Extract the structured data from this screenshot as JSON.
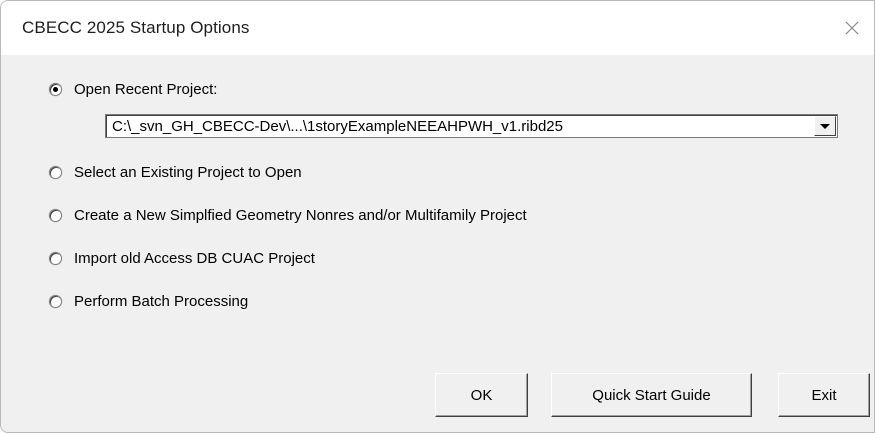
{
  "window": {
    "title": "CBECC 2025 Startup Options"
  },
  "options": {
    "open_recent": "Open Recent Project:",
    "select_existing": "Select an Existing Project to Open",
    "create_new": "Create a New Simplfied Geometry Nonres and/or Multifamily Project",
    "import_old": "Import old Access DB CUAC Project",
    "batch": "Perform Batch Processing",
    "selected": "open_recent"
  },
  "recent_project": {
    "value": "C:\\_svn_GH_CBECC-Dev\\...\\1storyExampleNEEAHPWH_v1.ribd25"
  },
  "buttons": {
    "ok": "OK",
    "quick_start": "Quick Start Guide",
    "exit": "Exit"
  },
  "icons": {
    "close": "close-icon",
    "dropdown": "chevron-down-icon"
  }
}
